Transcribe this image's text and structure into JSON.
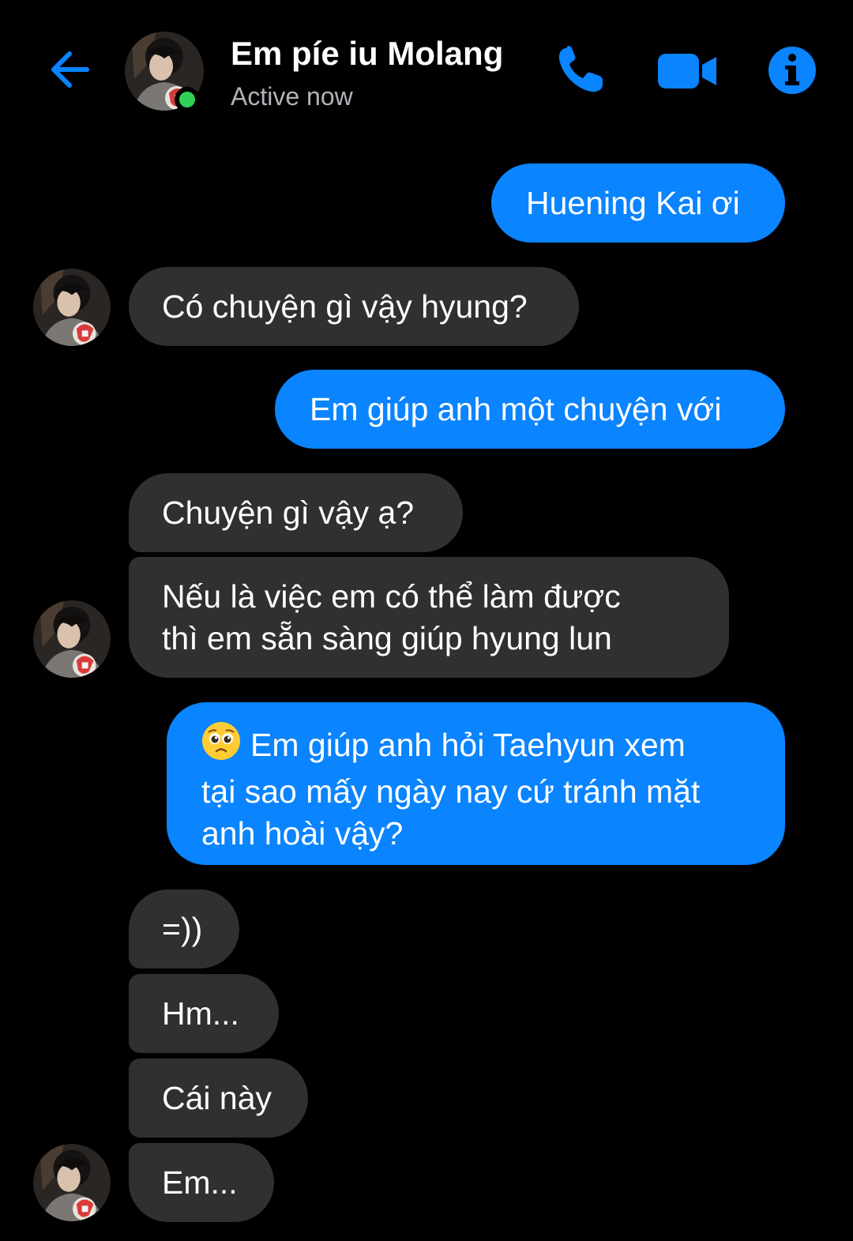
{
  "header": {
    "contact_name": "Em píe iu Molang",
    "status": "Active now",
    "icons": {
      "back": "back-arrow-icon",
      "phone": "phone-icon",
      "video": "video-camera-icon",
      "info": "info-icon"
    }
  },
  "colors": {
    "accent": "#0a84ff",
    "incoming_bubble": "#303030",
    "active_dot": "#31d158",
    "background": "#000000"
  },
  "messages": [
    {
      "from": "me",
      "text": "Huening Kai ơi"
    },
    {
      "from": "them",
      "text": "Có chuyện gì vậy hyung?"
    },
    {
      "from": "me",
      "text": "Em giúp anh một chuyện với"
    },
    {
      "from": "them",
      "text": "Chuyện gì vậy ạ?"
    },
    {
      "from": "them",
      "lines": [
        "Nếu là việc em có thể làm được",
        "thì em sẵn sàng giúp hyung lun"
      ]
    },
    {
      "from": "me",
      "emoji": "pleading-face-emoji",
      "lines": [
        "Em giúp anh hỏi Taehyun xem",
        "tại sao mấy ngày nay cứ tránh mặt",
        "anh hoài vậy?"
      ]
    },
    {
      "from": "them",
      "text": "=))"
    },
    {
      "from": "them",
      "text": "Hm..."
    },
    {
      "from": "them",
      "text": "Cái này"
    },
    {
      "from": "them",
      "text": "Em..."
    }
  ]
}
